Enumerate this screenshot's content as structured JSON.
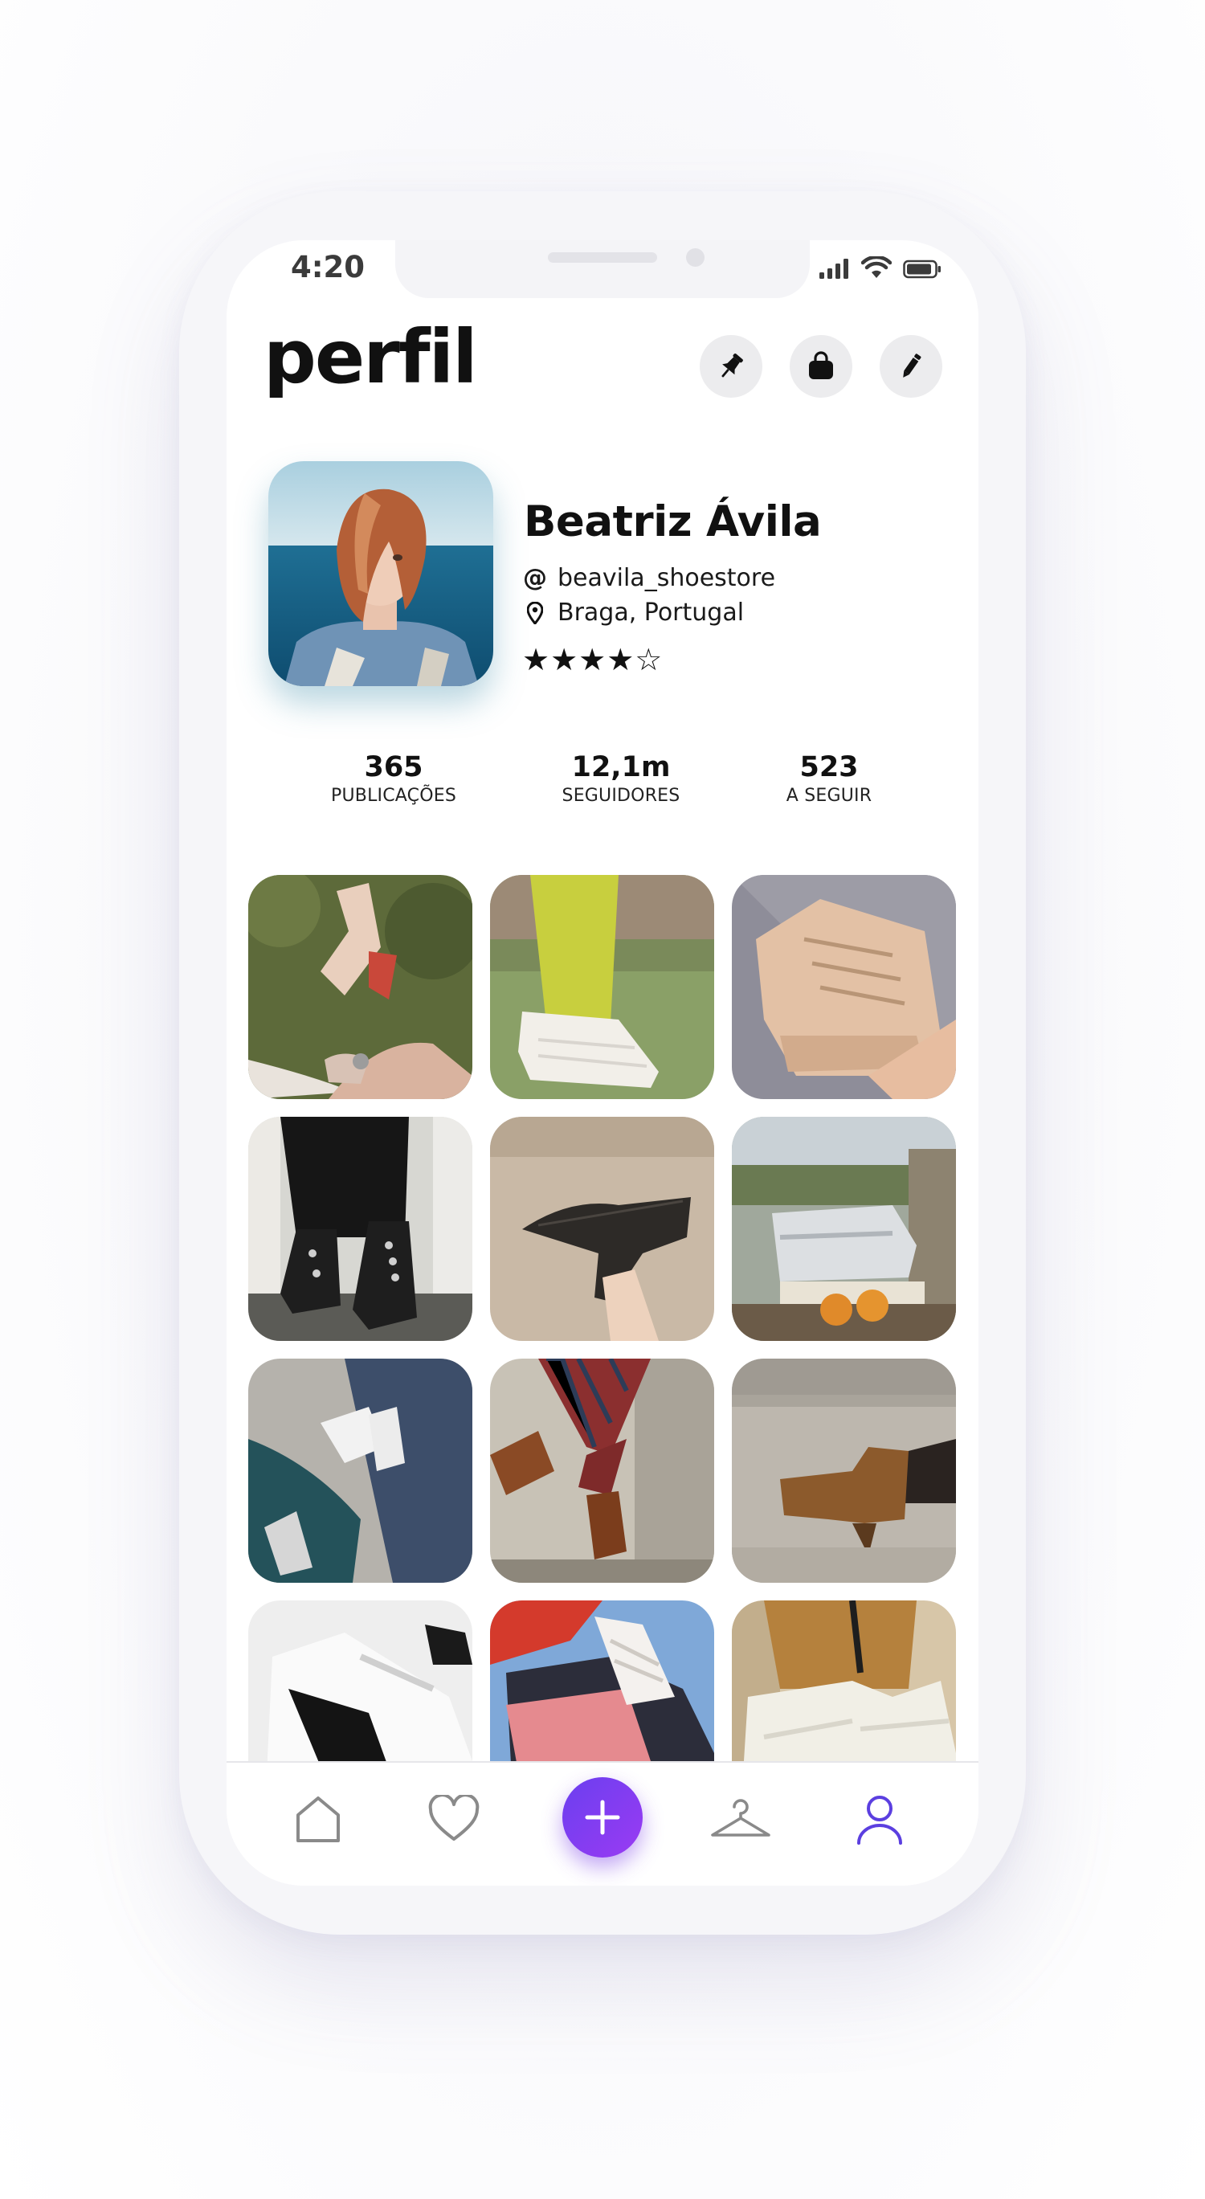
{
  "status_bar": {
    "time": "4:20"
  },
  "header": {
    "title": "perfil",
    "buttons": [
      {
        "icon": "pin-icon"
      },
      {
        "icon": "shopping-bag-icon"
      },
      {
        "icon": "pencil-icon"
      }
    ]
  },
  "profile": {
    "name": "Beatriz Ávila",
    "handle_prefix": "@",
    "handle": "beavila_shoestore",
    "location": "Braga, Portugal",
    "rating_text": "★★★★☆",
    "rating": 4,
    "rating_max": 5
  },
  "stats": [
    {
      "value": "365",
      "label": "PUBLICAÇÕES"
    },
    {
      "value": "12,1m",
      "label": "SEGUIDORES"
    },
    {
      "value": "523",
      "label": "A SEGUIR"
    }
  ],
  "posts": [
    {
      "subject": "beige-boots-on-grass"
    },
    {
      "subject": "white-sneakers-green-trousers"
    },
    {
      "subject": "beige-chunky-sneaker-in-hand"
    },
    {
      "subject": "black-studded-boots"
    },
    {
      "subject": "black-croc-heel-in-hand"
    },
    {
      "subject": "silver-sneakers-on-books"
    },
    {
      "subject": "sneakers-on-cobblestones"
    },
    {
      "subject": "brown-boots-plaid-trousers"
    },
    {
      "subject": "brown-croc-ankle-boot"
    },
    {
      "subject": "white-black-sneakers"
    },
    {
      "subject": "pink-sneaker-red-paint"
    },
    {
      "subject": "white-sneakers-tan-trousers"
    }
  ],
  "tab_bar": {
    "items": [
      {
        "icon": "home-icon"
      },
      {
        "icon": "heart-icon"
      },
      {
        "icon": "plus-icon"
      },
      {
        "icon": "hanger-icon"
      },
      {
        "icon": "user-icon",
        "active": true
      }
    ]
  },
  "colors": {
    "accent": "#6b3ff0",
    "accent_end": "#9a3bf2",
    "active_tab": "#5b3fe0",
    "inactive_tab": "#8a8a8a"
  }
}
